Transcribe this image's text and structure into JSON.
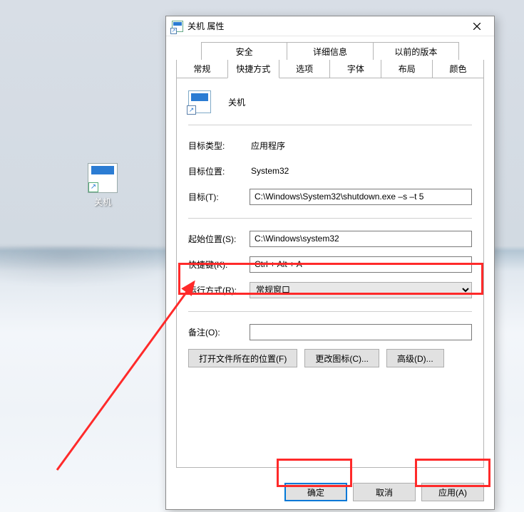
{
  "desktop_icon": {
    "label": "关机"
  },
  "dialog": {
    "title": "关机 属性",
    "tabs_row1": [
      "安全",
      "详细信息",
      "以前的版本"
    ],
    "tabs_row2": [
      "常规",
      "快捷方式",
      "选项",
      "字体",
      "布局",
      "颜色"
    ],
    "selected_tab": "快捷方式",
    "header_name": "关机",
    "fields": {
      "target_type": {
        "label": "目标类型:",
        "value": "应用程序"
      },
      "target_location": {
        "label": "目标位置:",
        "value": "System32"
      },
      "target": {
        "label": "目标(T):",
        "value": "C:\\Windows\\System32\\shutdown.exe –s –t 5"
      },
      "start_in": {
        "label": "起始位置(S):",
        "value": "C:\\Windows\\system32"
      },
      "shortcut_key": {
        "label": "快捷键(K):",
        "value": "Ctrl + Alt + A"
      },
      "run": {
        "label": "运行方式(R):",
        "value": "常规窗口"
      },
      "comment": {
        "label": "备注(O):",
        "value": ""
      }
    },
    "buttons": {
      "open_location": "打开文件所在的位置(F)",
      "change_icon": "更改图标(C)...",
      "advanced": "高级(D)..."
    },
    "footer": {
      "ok": "确定",
      "cancel": "取消",
      "apply": "应用(A)"
    }
  }
}
